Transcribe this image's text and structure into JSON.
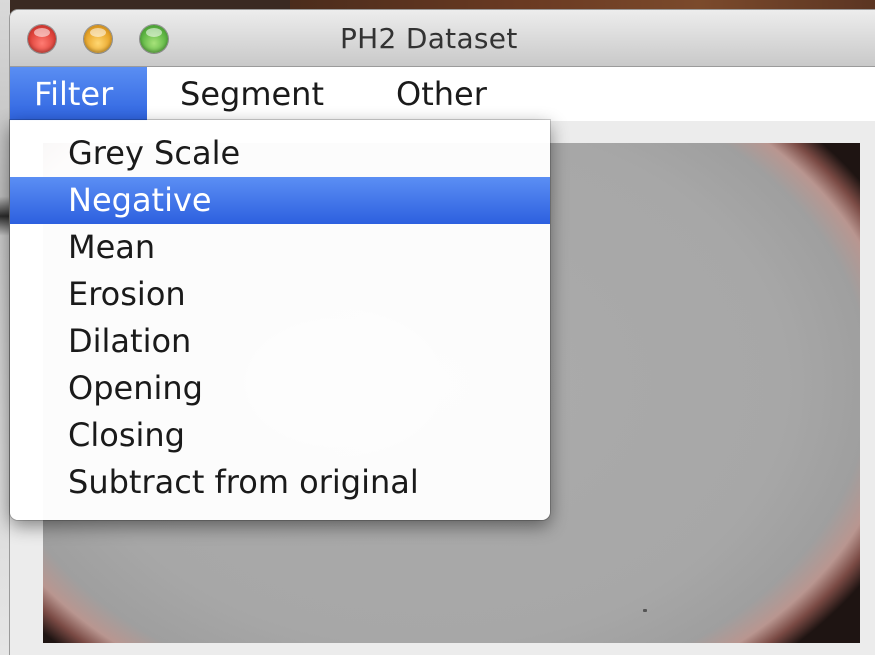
{
  "window": {
    "title": "PH2 Dataset"
  },
  "menubar": {
    "items": [
      {
        "label": "Filter",
        "active": true
      },
      {
        "label": "Segment",
        "active": false
      },
      {
        "label": "Other",
        "active": false
      }
    ]
  },
  "filter_menu": {
    "items": [
      {
        "label": "Grey Scale",
        "selected": false
      },
      {
        "label": "Negative",
        "selected": true
      },
      {
        "label": "Mean",
        "selected": false
      },
      {
        "label": "Erosion",
        "selected": false
      },
      {
        "label": "Dilation",
        "selected": false
      },
      {
        "label": "Opening",
        "selected": false
      },
      {
        "label": "Closing",
        "selected": false
      },
      {
        "label": "Subtract from original",
        "selected": false
      }
    ]
  },
  "colors": {
    "highlight": "#2f64e0",
    "close_button": "#e0443c",
    "minimize_button": "#e9a72c",
    "maximize_button": "#5fb744"
  }
}
